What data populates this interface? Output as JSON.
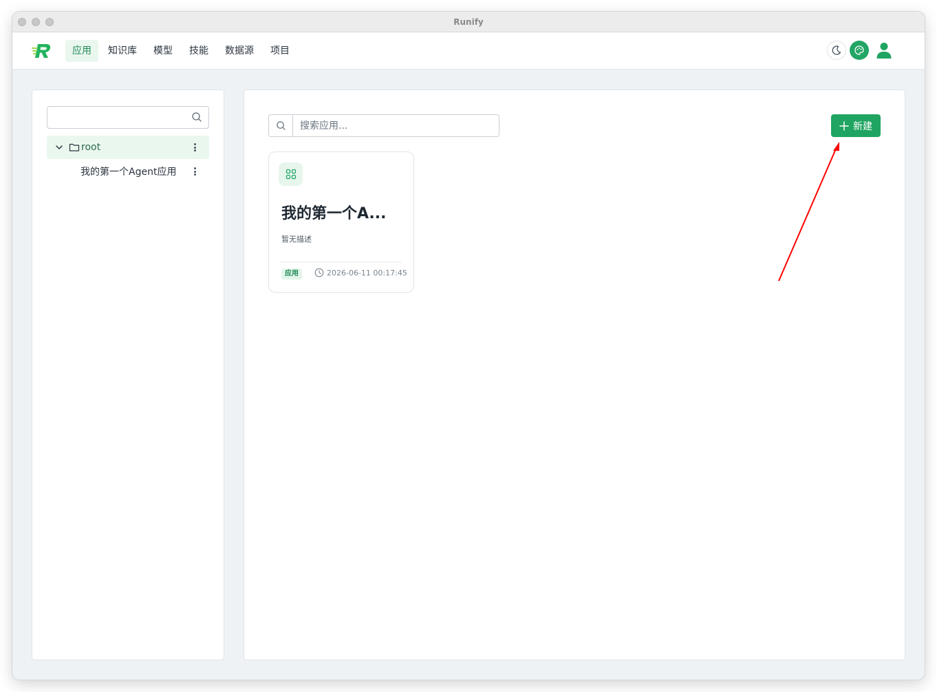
{
  "window": {
    "title": "Runify"
  },
  "nav": {
    "items": [
      {
        "label": "应用",
        "active": true
      },
      {
        "label": "知识库",
        "active": false
      },
      {
        "label": "模型",
        "active": false
      },
      {
        "label": "技能",
        "active": false
      },
      {
        "label": "数据源",
        "active": false
      },
      {
        "label": "项目",
        "active": false
      }
    ],
    "icons": [
      "moon-icon",
      "palette-icon",
      "user-icon"
    ]
  },
  "sidebar": {
    "search": {
      "value": "",
      "placeholder": ""
    },
    "tree": {
      "root_label": "root",
      "children": [
        {
          "label": "我的第一个Agent应用"
        }
      ]
    }
  },
  "main": {
    "search": {
      "placeholder": "搜索应用..."
    },
    "new_button_label": "新建",
    "cards": [
      {
        "title": "我的第一个A...",
        "description": "暂无描述",
        "tag": "应用",
        "timestamp": "2026-06-11 00:17:45",
        "icon": "apps-grid-icon"
      }
    ]
  },
  "colors": {
    "brand_green": "#1fa461",
    "active_nav_bg": "#eaf7ee",
    "annotation_arrow": "#ff0000"
  }
}
